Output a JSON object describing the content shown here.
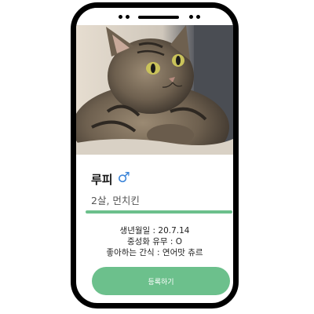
{
  "pet": {
    "name": "루피",
    "gender_symbol": "♂",
    "age_breed": "2살, 먼치킨"
  },
  "details": {
    "birthday": "생년월일 : 20.7.14",
    "neutered": "중성화 유무 : O",
    "favorite_snack": "좋아하는 간식 : 연어맛 츄르"
  },
  "actions": {
    "register_label": "등록하기"
  },
  "colors": {
    "accent": "#6cc08c",
    "gender": "#3b84d8",
    "frame": "#000000"
  },
  "icons": {
    "gender": "male-symbol-icon"
  }
}
